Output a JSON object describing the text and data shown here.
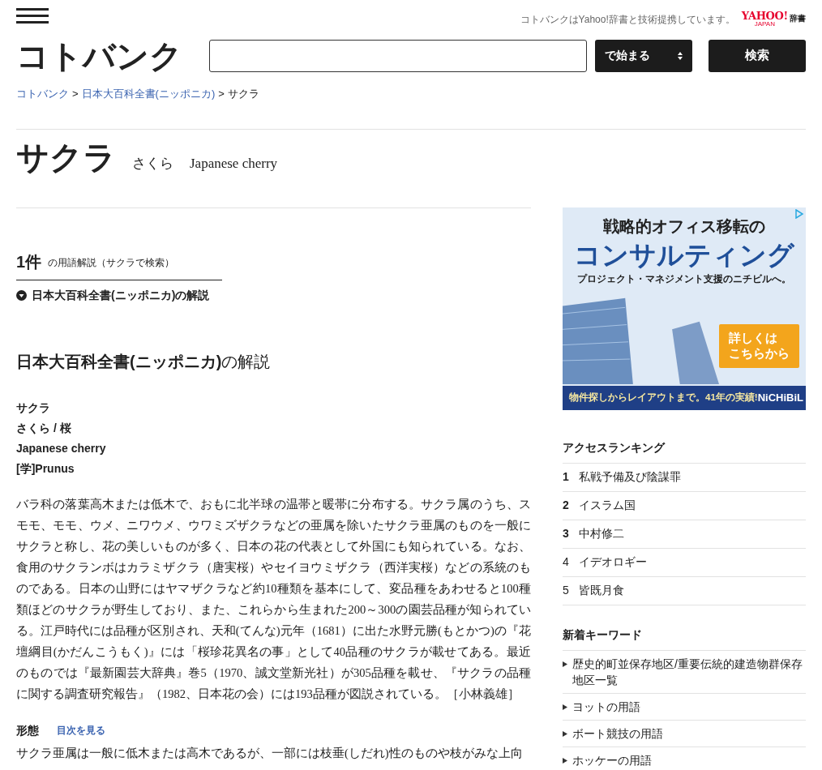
{
  "header": {
    "partner_note": "コトバンクはYahoo!辞書と技術提携しています。",
    "partner_logo": {
      "main": "YAHOO!",
      "sub": "JAPAN",
      "suffix": "辞書"
    },
    "logo": "コトバンク",
    "search": {
      "mode": "で始まる",
      "button": "検索"
    }
  },
  "breadcrumb": [
    {
      "label": "コトバンク",
      "link": true
    },
    {
      "separator": ">",
      "label": "日本大百科全書(ニッポニカ)",
      "link": true
    },
    {
      "separator": ">",
      "label": "サクラ",
      "link": false
    }
  ],
  "entry": {
    "title": "サクラ",
    "reading": "さくら",
    "english": "Japanese cherry"
  },
  "results": {
    "count": "1件",
    "summary": "の用語解説（サクラで検索）",
    "jump": "日本大百科全書(ニッポニカ)の解説"
  },
  "article": {
    "heading": "日本大百科全書(ニッポニカ)",
    "heading_suffix": "の解説",
    "headwords": [
      "サクラ",
      "さくら / 桜",
      "Japanese cherry",
      "[学]Prunus"
    ],
    "body": "バラ科の落葉高木または低木で、おもに北半球の温帯と暖帯に分布する。サクラ属のうち、スモモ、モモ、ウメ、ニワウメ、ウワミズザクラなどの亜属を除いたサクラ亜属のものを一般にサクラと称し、花の美しいものが多く、日本の花の代表として外国にも知られている。なお、食用のサクランボはカラミザクラ（唐実桜）やセイヨウミザクラ（西洋実桜）などの系統のものである。日本の山野にはヤマザクラなど約10種類を基本にして、変品種をあわせると100種類ほどのサクラが野生しており、また、これらから生まれた200～300の園芸品種が知られている。江戸時代には品種が区別され、天和(てんな)元年（1681）に出た水野元勝(もとかつ)の『花壇綱目(かだんこうもく)』には「桜珍花異名の事」として40品種のサクラが載せてある。最近のものでは『最新園芸大辞典』巻5（1970、誠文堂新光社）が305品種を載せ、『サクラの品種に関する調査研究報告』（1982、日本花の会）には193品種が図説されている。［小林義雄］",
    "section": {
      "title": "形態",
      "toc_link": "目次を見る",
      "body": "サクラ亜属は一般に低木または高木であるが、一部には枝垂(しだれ)性のものや枝がみな上向"
    }
  },
  "ad": {
    "line1": "戦略的オフィス移転の",
    "line2": "コンサルティング",
    "line3": "プロジェクト・マネジメント支援のニチビルへ。",
    "cta": [
      "詳しくは",
      "こちらから"
    ],
    "footer": "物件探しからレイアウトまで。41年の実績!",
    "brand": "NiCHiBiL"
  },
  "ranking": {
    "title": "アクセスランキング",
    "items": [
      {
        "rank": "1",
        "label": "私戦予備及び陰謀罪",
        "top": true
      },
      {
        "rank": "2",
        "label": "イスラム国",
        "top": true
      },
      {
        "rank": "3",
        "label": "中村修二",
        "top": true
      },
      {
        "rank": "4",
        "label": "イデオロギー",
        "top": false
      },
      {
        "rank": "5",
        "label": "皆既月食",
        "top": false
      }
    ]
  },
  "new_keywords": {
    "title": "新着キーワード",
    "items": [
      "歴史的町並保存地区/重要伝統的建造物群保存地区一覧",
      "ヨットの用語",
      "ボート競技の用語",
      "ホッケーの用語"
    ]
  }
}
